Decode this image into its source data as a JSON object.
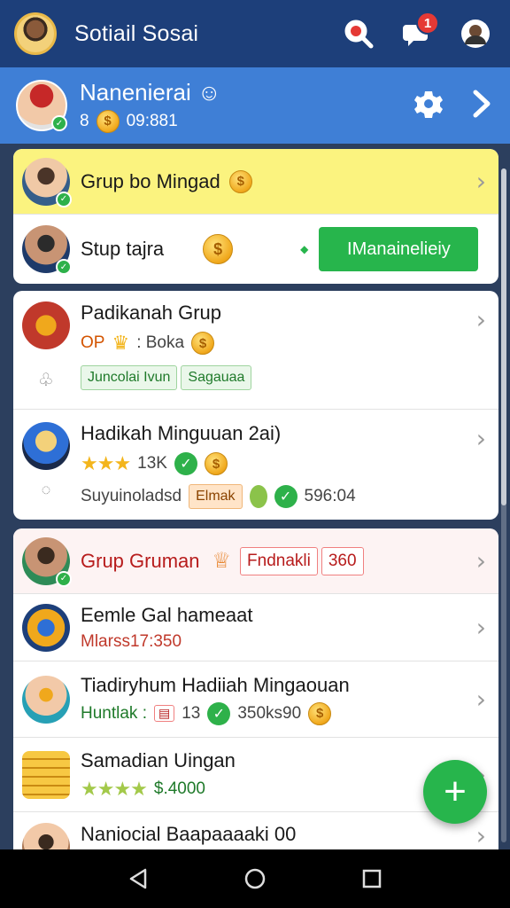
{
  "appbar": {
    "title": "Sotiail Sosai",
    "notification_count": "1"
  },
  "profile": {
    "name": "Nanenierai",
    "level": "8",
    "coins": "09:881"
  },
  "card1": {
    "row1": {
      "title": "Grup bo Mingad"
    },
    "row2": {
      "title": "Stup tajra",
      "button": "IManainelieiy"
    }
  },
  "card2": {
    "row1": {
      "title": "Padikanah Grup",
      "meta_prefix": "OP",
      "meta_text": ": Boka",
      "chip1": "Juncolai Ivun",
      "chip2": "Sagauaa"
    },
    "row2": {
      "title": "Hadikah Minguuan 2ai)",
      "count": "13K",
      "meta_text": "Suyuinoladsd",
      "chip": "Elmak",
      "time": "596:04"
    }
  },
  "card3": {
    "row1": {
      "title": "Grup Gruman",
      "chip1": "Fndnakli",
      "chip2": "360"
    },
    "row2": {
      "title": "Eemle Gal hameaat",
      "sub": "Mlarss17:350"
    },
    "row3": {
      "title": "Tiadiryhum Hadiiah Mingaouan",
      "sub_label": "Huntlak :",
      "sub_num": "13",
      "sub_count": "350ks90"
    },
    "row4": {
      "title": "Samadian Uingan",
      "sub": "$.4000"
    },
    "row5": {
      "title": "Naniocial Baapaaaaki 00"
    }
  },
  "fab": {
    "label": "+"
  },
  "colors": {
    "header": "#1d3f7a",
    "profile": "#3f7fd6",
    "highlight": "#fbf37f",
    "green": "#27b54c",
    "coin": "#f0a81c"
  }
}
